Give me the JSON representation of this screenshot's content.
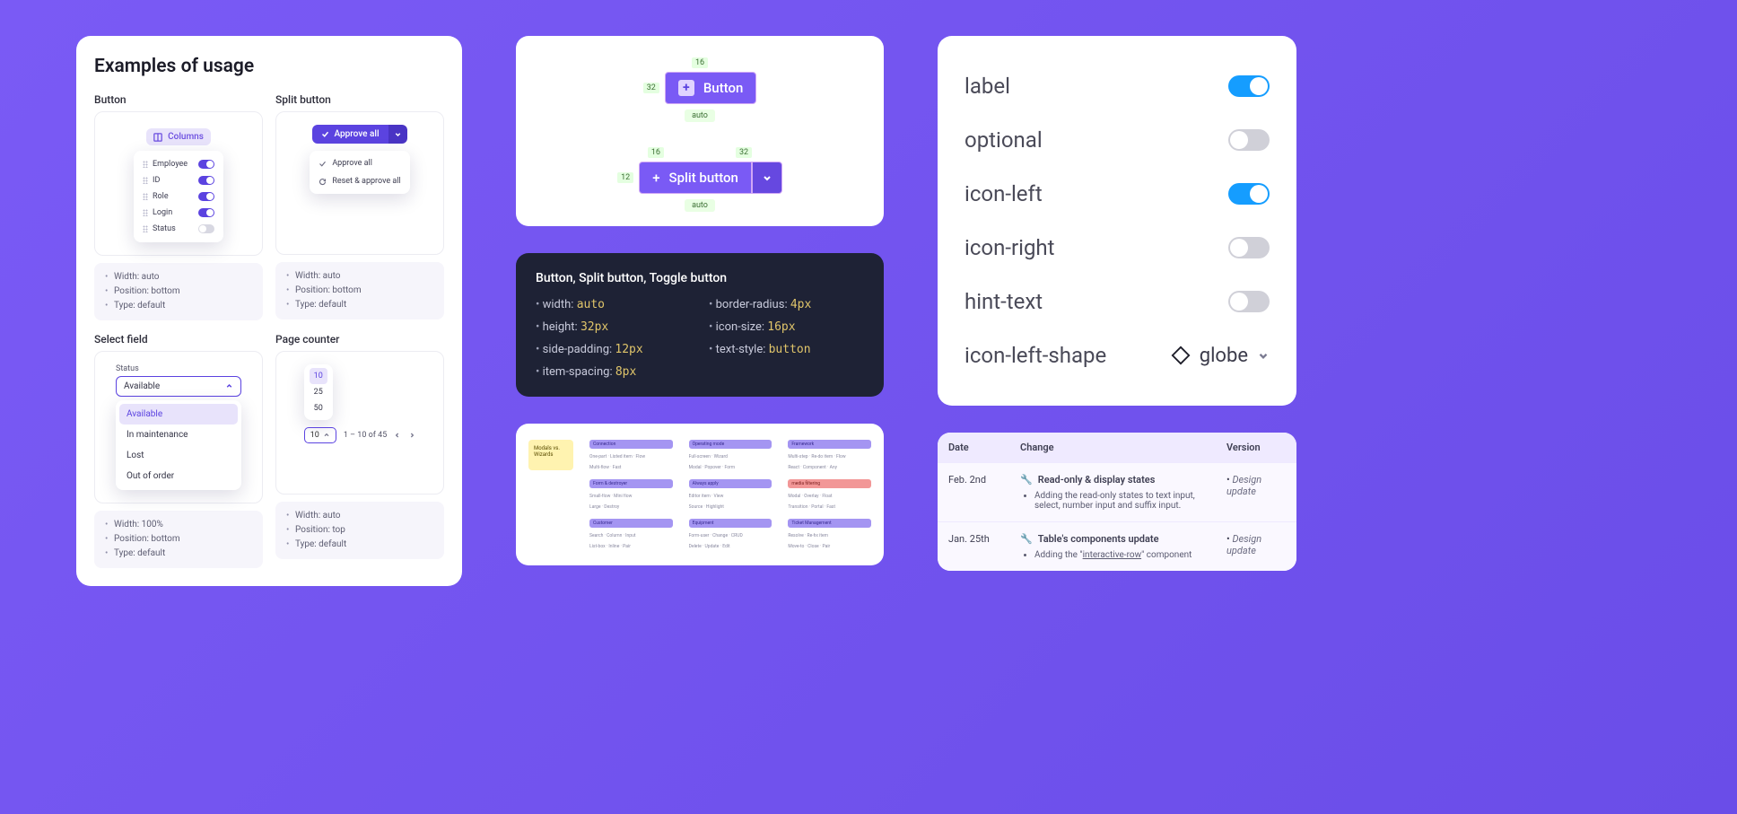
{
  "examples": {
    "heading": "Examples of usage",
    "button": {
      "label": "Button",
      "chip": "Columns",
      "rows": [
        "Employee",
        "ID",
        "Role",
        "Login",
        "Status"
      ],
      "status_on": [
        true,
        true,
        true,
        true,
        false
      ],
      "props": [
        "Width: auto",
        "Position: bottom",
        "Type: default"
      ]
    },
    "split": {
      "label": "Split button",
      "main": "Approve all",
      "menu": [
        "Approve all",
        "Reset & approve all"
      ],
      "props": [
        "Width: auto",
        "Position: bottom",
        "Type: default"
      ]
    },
    "select": {
      "label": "Select field",
      "field_label": "Status",
      "value": "Available",
      "options": [
        "Available",
        "In maintenance",
        "Lost",
        "Out of order"
      ],
      "props": [
        "Width: 100%",
        "Position: bottom",
        "Type: default"
      ]
    },
    "page": {
      "label": "Page counter",
      "sizes": [
        "10",
        "25",
        "50"
      ],
      "current": "10",
      "range": "1 – 10 of 45",
      "props": [
        "Width: auto",
        "Position: top",
        "Type: default"
      ]
    }
  },
  "spec": {
    "button_label": "Button",
    "split_label": "Split button",
    "meas_16": "16",
    "meas_32": "32",
    "meas_12": "12",
    "auto": "auto",
    "panel_title": "Button, Split button, Toggle button",
    "props": [
      {
        "k": "width",
        "v": "auto"
      },
      {
        "k": "height",
        "v": "32px"
      },
      {
        "k": "side-padding",
        "v": "12px"
      },
      {
        "k": "item-spacing",
        "v": "8px"
      },
      {
        "k": "border-radius",
        "v": "4px"
      },
      {
        "k": "icon-size",
        "v": "16px"
      },
      {
        "k": "text-style",
        "v": "button"
      }
    ]
  },
  "toggles": {
    "rows": [
      {
        "name": "label",
        "on": true
      },
      {
        "name": "optional",
        "on": false
      },
      {
        "name": "icon-left",
        "on": true
      },
      {
        "name": "icon-right",
        "on": false
      },
      {
        "name": "hint-text",
        "on": false
      }
    ],
    "shape_label": "icon-left-shape",
    "shape_value": "globe"
  },
  "overview": {
    "note": "Modals vs. Wizards",
    "cols": [
      {
        "h": "Connection",
        "lines": [
          "One-part · Listed item · Flow",
          "Multi-flow · Fast"
        ]
      },
      {
        "h": "Operating mode",
        "lines": [
          "Full-screen · Wizard",
          "Modal · Popover · Form"
        ]
      },
      {
        "h": "Framework",
        "lines": [
          "Multi-step · Re-do item · Flow",
          "React · Component · Any"
        ]
      },
      {
        "h": "Form & destroyer",
        "lines": [
          "Small-flow · Mini flow",
          "Large · Destroy"
        ]
      },
      {
        "h": "Always apply",
        "lines": [
          "Editor item · View",
          "Source · Highlight"
        ]
      },
      {
        "h": "media filtering",
        "red": true,
        "lines": [
          "Modal · Overlay · Float",
          "Transition · Portal · Fast"
        ]
      },
      {
        "h": "Customer",
        "lines": [
          "Search · Column · Input",
          "List-box · Inline · Pair"
        ]
      },
      {
        "h": "Equipment",
        "lines": [
          "Form-user · Change · CRUD",
          "Delete · Update · Edit"
        ]
      },
      {
        "h": "Ticket Management",
        "lines": [
          "Resolve · Re-fix item",
          "Move-to · Close · Pair"
        ]
      }
    ]
  },
  "log": {
    "head": [
      "Date",
      "Change",
      "Version"
    ],
    "rows": [
      {
        "date": "Feb. 2nd",
        "title": "Read-only & display states",
        "items": [
          "Adding the read-only states to text input, select, number input and suffix input."
        ],
        "version": "Design update"
      },
      {
        "date": "Jan. 25th",
        "title": "Table's components update",
        "items": [
          "Adding the \"interactive-row\" component"
        ],
        "link": "interactive-row",
        "version": "Design update"
      }
    ]
  }
}
